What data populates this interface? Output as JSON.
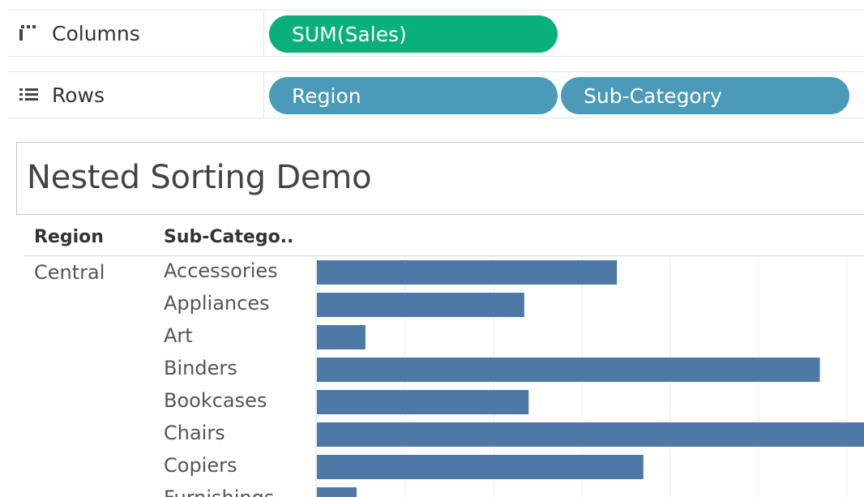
{
  "shelves": {
    "columns": {
      "label": "Columns",
      "pills": [
        "SUM(Sales)"
      ]
    },
    "rows": {
      "label": "Rows",
      "pills": [
        "Region",
        "Sub-Category"
      ]
    }
  },
  "title": "Nested Sorting Demo",
  "headers": {
    "region": "Region",
    "subcategory": "Sub-Catego.."
  },
  "colors": {
    "bar": "#4e79a7",
    "pill_measure": "#09b07a",
    "pill_dimension": "#4a9ab8"
  },
  "chart_data": {
    "type": "bar",
    "orientation": "horizontal",
    "region": "Central",
    "categories": [
      "Accessories",
      "Appliances",
      "Art",
      "Binders",
      "Bookcases",
      "Chairs",
      "Copiers",
      "Furnishings"
    ],
    "values": [
      34,
      23.5,
      5.5,
      57,
      24,
      62,
      37,
      4.5
    ],
    "xlim": [
      0,
      62
    ],
    "grid": true
  }
}
